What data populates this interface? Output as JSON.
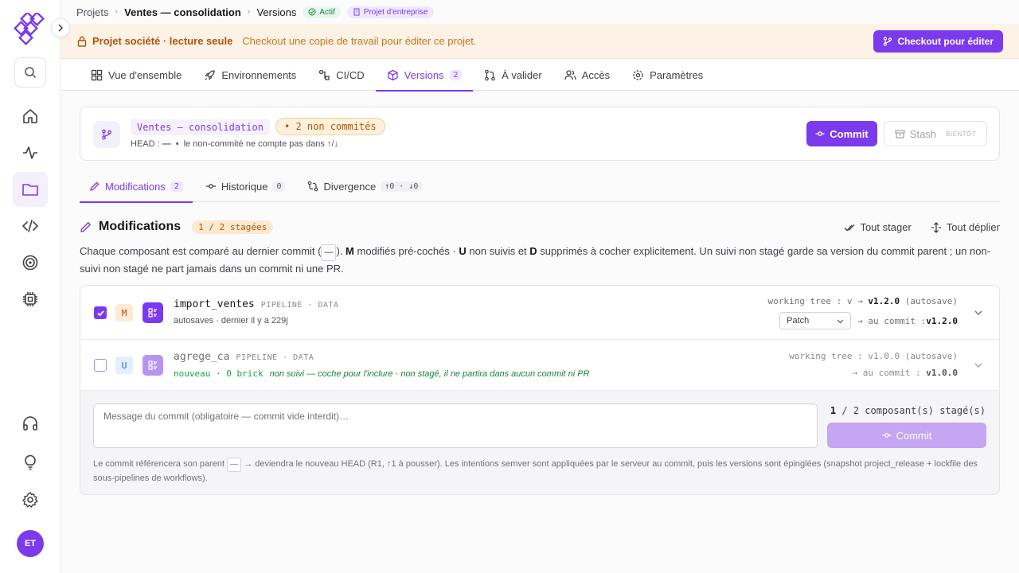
{
  "breadcrumb": {
    "root": "Projets",
    "project": "Ventes — consolidation",
    "current": "Versions",
    "status_badge": "Actif",
    "type_badge": "Projet d'entreprise"
  },
  "banner": {
    "title": "Projet société · lecture seule",
    "subtitle": "Checkout une copie de travail pour éditer ce projet.",
    "button": "Checkout pour éditer"
  },
  "tabs": [
    {
      "label": "Vue d'ensemble",
      "icon": "grid-icon"
    },
    {
      "label": "Environnements",
      "icon": "rocket-icon"
    },
    {
      "label": "CI/CD",
      "icon": "pipeline-icon"
    },
    {
      "label": "Versions",
      "icon": "package-icon",
      "count": "2",
      "active": true
    },
    {
      "label": "À valider",
      "icon": "pull-request-icon"
    },
    {
      "label": "Accès",
      "icon": "users-icon"
    },
    {
      "label": "Paramètres",
      "icon": "gear-icon"
    }
  ],
  "header": {
    "branch": "Ventes — consolidation",
    "uncommitted": "• 2 non commités",
    "head_label": "HEAD :",
    "head_value": "—",
    "head_note": "le non-commité ne compte pas dans ↑/↓",
    "commit_button": "Commit",
    "stash_button": "Stash",
    "stash_soon": "BIENTÔT"
  },
  "subtabs": [
    {
      "label": "Modifications",
      "count": "2",
      "active": true
    },
    {
      "label": "Historique",
      "count": "0"
    },
    {
      "label": "Divergence",
      "count": "↑0 · ↓0"
    }
  ],
  "modifications": {
    "title": "Modifications",
    "stage_badge": "1 / 2 stagées",
    "stage_all": "Tout stager",
    "expand_all": "Tout déplier",
    "desc_1": "Chaque composant est comparé au dernier commit (",
    "desc_dash": "—",
    "desc_2": "). ",
    "desc_m": "M",
    "desc_3": " modifiés pré-cochés · ",
    "desc_u": "U",
    "desc_4": " non suivis et ",
    "desc_d": "D",
    "desc_5": " supprimés à cocher explicitement. Un suivi non stagé garde sa version du commit parent ; un non-suivi non stagé ne part jamais dans un commit ni une PR."
  },
  "rows": [
    {
      "checked": true,
      "letter": "M",
      "name": "import_ventes",
      "type": "PIPELINE · DATA",
      "sub": "autosaves · dernier il y a 229j",
      "wt_label": "working tree : v → ",
      "wt_version": "v1.2.0",
      "wt_suffix": " (autosave)",
      "bump": "Patch",
      "commit_label": "→ au commit : ",
      "commit_version": "v1.2.0"
    },
    {
      "checked": false,
      "letter": "U",
      "name": "agrege_ca",
      "type": "PIPELINE · DATA",
      "sub_new": "nouveau · 0 brick",
      "hint": "non suivi — coche pour l'inclure · non stagé, il ne partira dans aucun commit ni PR",
      "wt_text": "working tree : v1.0.0 (autosave)",
      "commit_label": "→ au commit : ",
      "commit_version": "v1.0.0"
    }
  ],
  "commit": {
    "placeholder": "Message du commit (obligatoire — commit vide interdit)…",
    "staged_a": "1",
    "staged_b": " / 2 composant(s) stagé(s)",
    "button": "Commit",
    "note_1": "Le commit référencera son parent ",
    "note_dash": "—",
    "note_2": " → deviendra le nouveau HEAD (R1, ↑1 à pousser). Les intentions semver sont appliquées par le serveur au commit, puis les versions sont épinglées (snapshot project_release + lockfile des sous-pipelines de workflows)."
  },
  "user": {
    "initials": "ET"
  },
  "colors": {
    "accent": "#7c3aed",
    "warning": "#b45309",
    "success": "#15803d"
  }
}
